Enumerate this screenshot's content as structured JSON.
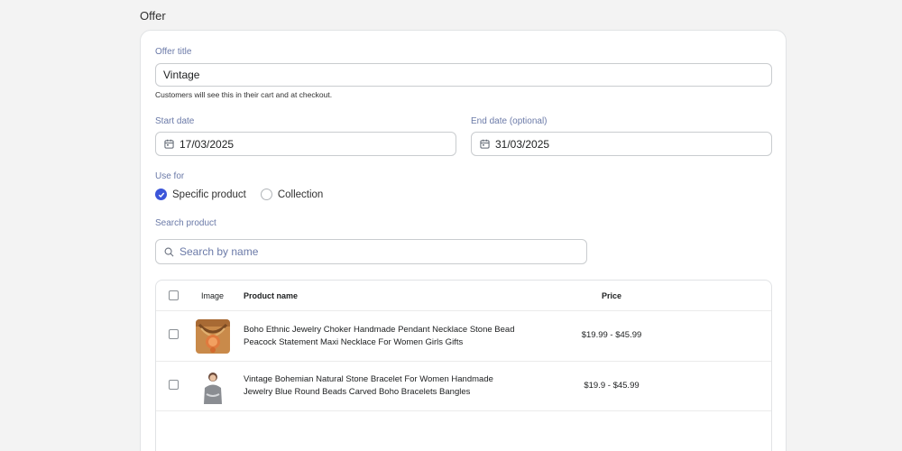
{
  "section": {
    "heading": "Offer"
  },
  "offer": {
    "title_label": "Offer title",
    "title_value": "Vintage",
    "title_help": "Customers will see this in their cart and at checkout."
  },
  "dates": {
    "start_label": "Start date",
    "start_value": "17/03/2025",
    "end_label": "End date (optional)",
    "end_value": "31/03/2025"
  },
  "use_for": {
    "label": "Use for",
    "options": [
      {
        "label": "Specific product",
        "checked": true
      },
      {
        "label": "Collection",
        "checked": false
      }
    ]
  },
  "search": {
    "label": "Search product",
    "placeholder": "Search by name"
  },
  "table": {
    "headers": {
      "image": "Image",
      "name": "Product name",
      "price": "Price"
    },
    "rows": [
      {
        "name_line1": "Boho Ethnic Jewelry Choker Handmade Pendant Necklace Stone Bead",
        "name_line2": "Peacock Statement Maxi Necklace For Women Girls Gifts",
        "price": "$19.99 - $45.99"
      },
      {
        "name_line1": "Vintage Bohemian Natural Stone Bracelet For Women Handmade",
        "name_line2": "Jewelry Blue Round Beads Carved Boho Bracelets Bangles",
        "price": "$19.9 - $45.99"
      }
    ]
  },
  "colors": {
    "accent": "#3b55d9",
    "label": "#6b7aa8",
    "border": "#c9cccf"
  }
}
